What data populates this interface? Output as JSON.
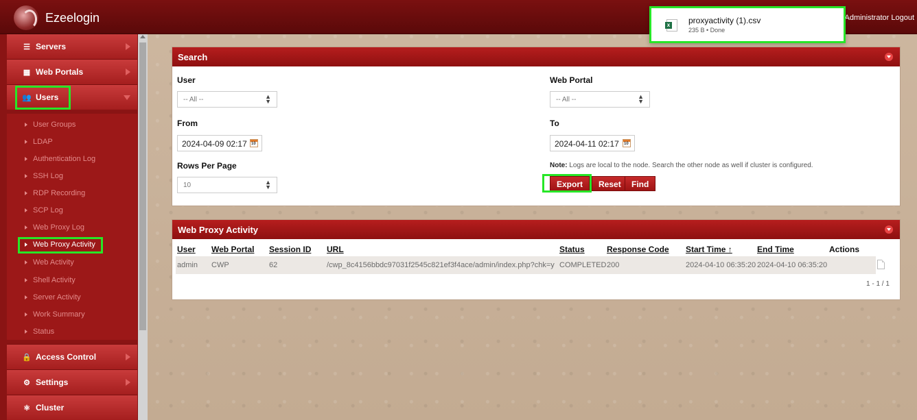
{
  "app": {
    "name": "Ezeelogin",
    "user_logout": "Administrator Logout"
  },
  "download": {
    "filename": "proxyactivity (1).csv",
    "meta": "235 B • Done"
  },
  "sidebar": {
    "menu": [
      {
        "label": "Servers",
        "icon": "☰"
      },
      {
        "label": "Web Portals",
        "icon": "▦"
      },
      {
        "label": "Users",
        "icon": "👥"
      },
      {
        "label": "Access Control",
        "icon": "🔒"
      },
      {
        "label": "Settings",
        "icon": "⚙"
      },
      {
        "label": "Cluster",
        "icon": "⚛"
      }
    ],
    "submenu": [
      "User Groups",
      "LDAP",
      "Authentication Log",
      "SSH Log",
      "RDP Recording",
      "SCP Log",
      "Web Proxy Log",
      "Web Proxy Activity",
      "Web Activity",
      "Shell Activity",
      "Server Activity",
      "Work Summary",
      "Status"
    ]
  },
  "search": {
    "title": "Search",
    "user_label": "User",
    "user_value": "-- All --",
    "portal_label": "Web Portal",
    "portal_value": "-- All --",
    "from_label": "From",
    "from_value": "2024-04-09 02:17",
    "to_label": "To",
    "to_value": "2024-04-11 02:17",
    "rows_label": "Rows Per Page",
    "rows_value": "10",
    "note_bold": "Note:",
    "note_text": " Logs are local to the node. Search the other node as well if cluster is configured.",
    "export": "Export",
    "reset": "Reset",
    "find": "Find"
  },
  "activity": {
    "title": "Web Proxy Activity",
    "headers": [
      "User",
      "Web Portal",
      "Session ID",
      "URL",
      "Status",
      "Response Code",
      "Start Time ↑",
      "End Time",
      "Actions"
    ],
    "rows": [
      [
        "admin",
        "CWP",
        "62",
        "/cwp_8c4156bbdc97031f2545c821ef3f4ace/admin/index.php?chk=y",
        "COMPLETED",
        "200",
        "2024-04-10 06:35:20",
        "2024-04-10 06:35:20"
      ]
    ],
    "pager": "1 - 1 / 1"
  }
}
